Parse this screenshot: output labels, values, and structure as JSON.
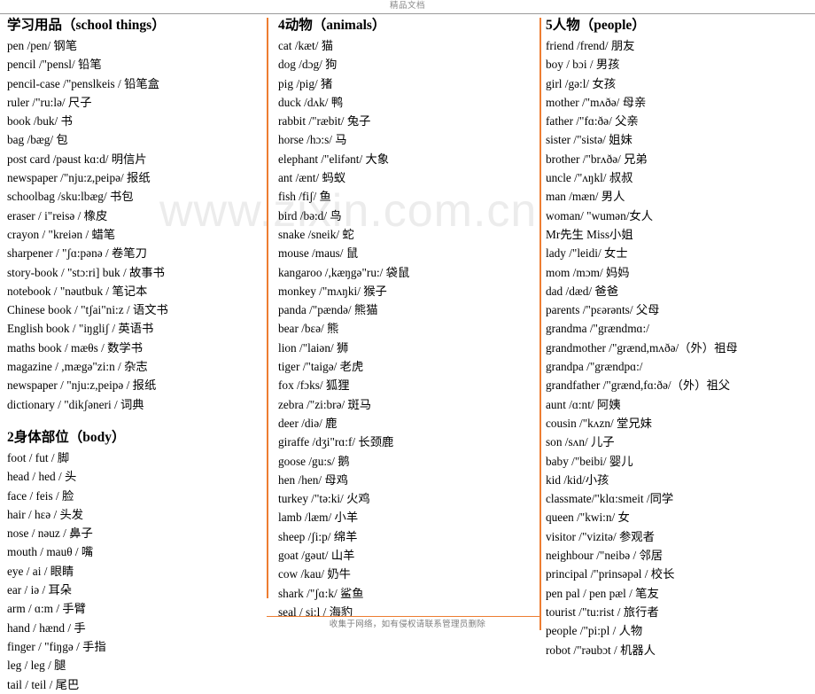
{
  "header": {
    "title": "精品文档"
  },
  "watermark": {
    "text": "www.zixin.com.cn"
  },
  "footer": {
    "notice": "收集于网络，如有侵权请联系管理员删除"
  },
  "colors": {
    "divider": "#ED7D31",
    "header_rule": "#9b9b9b",
    "watermark": "#ececec",
    "text": "#000000"
  },
  "columns": [
    {
      "id": "column-left",
      "sections": [
        {
          "id": "section-school-things",
          "number": "",
          "title_cjk": "学习用品",
          "title_latin": "（school things）",
          "title_full": "学习用品（school things）",
          "entries": [
            "pen /pen/ 钢笔",
            "pencil /\"pensl/ 铅笔",
            "pencil-case /\"penslkeis / 铅笔盒",
            "ruler /\"ru:lə/ 尺子",
            "book /buk/ 书",
            "bag /bæg/ 包",
            "post card /pəust kɑ:d/ 明信片",
            "newspaper /\"nju:z,peipə/ 报纸",
            "schoolbag /sku:lbæg/ 书包",
            "eraser / i\"reisə / 橡皮",
            "crayon / \"kreiən / 蜡笔",
            "sharpener / \"ʃɑ:pənə / 卷笔刀",
            "story-book / \"stɔ:ri] buk / 故事书",
            "notebook / \"nəutbuk / 笔记本",
            "Chinese book  / \"tʃai\"ni:z / 语文书",
            "English book / \"iŋgliʃ / 英语书",
            "maths book  / mæθs / 数学书",
            "magazine / ,mægə\"zi:n / 杂志",
            "newspaper / \"nju:z,peipə / 报纸",
            "dictionary / \"dikʃəneri / 词典"
          ]
        },
        {
          "id": "section-body",
          "number": "2",
          "title_cjk": "身体部位",
          "title_latin": "（body）",
          "title_full": "2身体部位（body）",
          "entries": [
            "foot / fut / 脚",
            "head / hed / 头",
            "face / feis / 脸",
            "hair / hɛə / 头发",
            "nose / nəuz / 鼻子",
            "mouth / mauθ / 嘴",
            "eye / ai / 眼睛",
            "ear / iə / 耳朵",
            "arm / ɑ:m / 手臂",
            "hand / hænd / 手",
            "finger / \"fiŋgə / 手指",
            "leg / leg / 腿",
            "tail / teil / 尾巴"
          ]
        }
      ]
    },
    {
      "id": "column-middle",
      "sections": [
        {
          "id": "section-animals",
          "number": "4",
          "title_cjk": "动物",
          "title_latin": "（animals）",
          "title_full": "4动物（animals）",
          "entries": [
            "cat /kæt/ 猫",
            "dog /dɔg/ 狗",
            "pig /pig/ 猪",
            "duck /dʌk/ 鸭",
            "rabbit /\"ræbit/ 兔子",
            "horse /hɔ:s/ 马",
            "elephant /\"elifənt/ 大象",
            "ant /ænt/ 蚂蚁",
            "fish /fiʃ/ 鱼",
            "bird /bə:d/ 鸟",
            "snake /sneik/ 蛇",
            "mouse /maus/ 鼠",
            "kangaroo /,kæŋgə\"ru:/ 袋鼠",
            "monkey /\"mʌŋki/ 猴子",
            "panda /\"pændə/ 熊猫",
            "bear /bɛə/ 熊",
            "lion /\"laiən/ 狮",
            "tiger /\"taigə/ 老虎",
            "fox  /fɔks/ 狐狸",
            "zebra /\"zi:brə/ 斑马",
            "deer /diə/ 鹿",
            "giraffe /dʒi\"rɑ:f/ 长颈鹿",
            "goose /gu:s/ 鹅",
            "hen /hen/ 母鸡",
            "turkey /\"tə:ki/ 火鸡",
            "lamb /læm/ 小羊",
            "sheep /ʃi:p/ 绵羊",
            "goat /gəut/ 山羊",
            "cow /kau/ 奶牛",
            "shark /\"ʃɑ:k/ 鲨鱼",
            "seal / si:l / 海豹"
          ]
        }
      ]
    },
    {
      "id": "column-right",
      "sections": [
        {
          "id": "section-people",
          "number": "5",
          "title_cjk": "人物",
          "title_latin": "（people）",
          "title_full": "5人物（people）",
          "entries": [
            "friend /frend/ 朋友",
            "boy / bɔi / 男孩",
            "girl /gə:l/ 女孩",
            "mother /\"mʌðə/ 母亲",
            "father /\"fɑ:ðə/ 父亲",
            "sister /\"sistə/ 姐妹",
            "brother /\"brʌðə/ 兄弟",
            "uncle /\"ʌŋkl/ 叔叔",
            "man /mæn/ 男人",
            "woman/ \"wumən/女人",
            "Mr先生  Miss小姐",
            "lady /\"leidi/ 女士",
            "mom /mɔm/ 妈妈",
            "dad /dæd/ 爸爸",
            "parents /\"pɛərənts/ 父母",
            "grandma /\"grændmɑ:/",
            "grandmother /\"grænd,mʌðə/（外）祖母",
            "grandpa  /\"grændpɑ:/",
            "grandfather /\"grænd,fɑ:ðə/（外）祖父",
            "aunt /ɑ:nt/ 阿姨",
            "cousin /\"kʌzn/ 堂兄妹",
            "son /sʌn/ 儿子",
            "baby /\"beibi/ 婴儿",
            "kid /kid/小孩",
            "classmate/\"klɑ:smeit /同学",
            "queen /\"kwi:n/ 女",
            "visitor /\"vizitə/ 参观者",
            "neighbour /\"neibə / 邻居",
            "principal /\"prinsəpəl / 校长",
            "pen pal / pen pæl / 笔友",
            "tourist /\"tu:rist / 旅行者",
            "people /\"pi:pl / 人物",
            "robot /\"rəubɔt / 机器人"
          ]
        }
      ]
    }
  ]
}
